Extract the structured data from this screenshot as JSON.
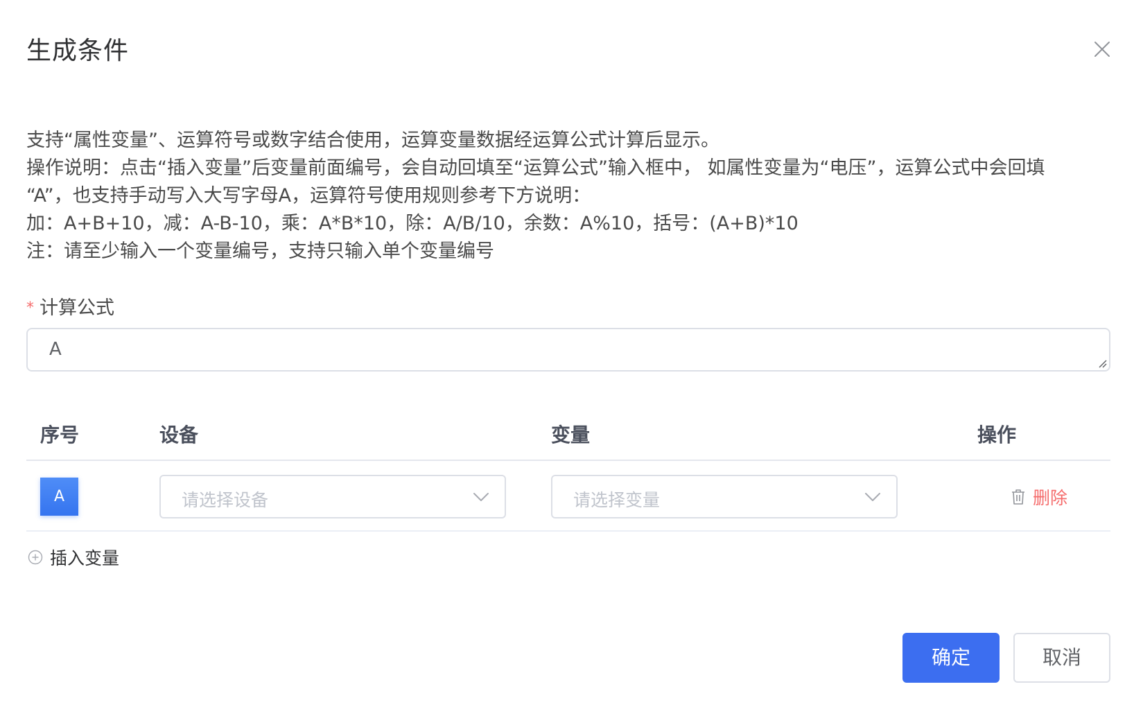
{
  "dialog": {
    "title": "生成条件",
    "close_icon": "close-icon"
  },
  "description": {
    "line1": "支持“属性变量”、运算符号或数字结合使用，运算变量数据经运算公式计算后显示。",
    "line2": "操作说明：点击“插入变量”后变量前面编号，会自动回填至“运算公式”输入框中， 如属性变量为“电压”，运算公式中会回填",
    "line3": "“A”，也支持手动写入大写字母A，运算符号使用规则参考下方说明：",
    "line4": "加：A+B+10，减：A-B-10，乘：A*B*10，除：A/B/10，余数：A%10，括号：(A+B)*10",
    "line5": "注：请至少输入一个变量编号，支持只输入单个变量编号"
  },
  "form": {
    "required_mark": "*",
    "formula_label": "计算公式",
    "formula_value": "A"
  },
  "table": {
    "headers": {
      "index": "序号",
      "device": "设备",
      "variable": "变量",
      "action": "操作"
    },
    "rows": [
      {
        "index": "A",
        "device_placeholder": "请选择设备",
        "variable_placeholder": "请选择变量",
        "delete_label": "删除"
      }
    ]
  },
  "insert_variable_label": "插入变量",
  "buttons": {
    "confirm": "确定",
    "cancel": "取消"
  },
  "colors": {
    "primary": "#3c6ef0",
    "danger": "#f56c6c",
    "placeholder": "#c0c4cc",
    "border": "#dcdfe6"
  }
}
